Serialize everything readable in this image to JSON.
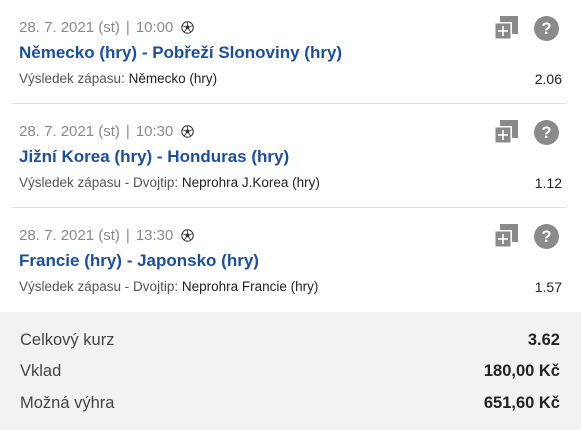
{
  "bets": [
    {
      "date": "28. 7. 2021 (st)",
      "time": "10:00",
      "match": "Německo (hry) - Pobřeží Slonoviny (hry)",
      "market": "Výsledek zápasu:",
      "pick": "Německo (hry)",
      "odd": "2.06"
    },
    {
      "date": "28. 7. 2021 (st)",
      "time": "10:30",
      "match": "Jižní Korea (hry) - Honduras (hry)",
      "market": "Výsledek zápasu - Dvojtip:",
      "pick": "Neprohra J.Korea (hry)",
      "odd": "1.12"
    },
    {
      "date": "28. 7. 2021 (st)",
      "time": "13:30",
      "match": "Francie (hry) - Japonsko (hry)",
      "market": "Výsledek zápasu - Dvojtip:",
      "pick": "Neprohra Francie (hry)",
      "odd": "1.57"
    }
  ],
  "summary": {
    "total_odds_label": "Celkový kurz",
    "total_odds_value": "3.62",
    "stake_label": "Vklad",
    "stake_value": "180,00 Kč",
    "win_label": "Možná výhra",
    "win_value": "651,60 Kč"
  },
  "icons": {
    "add": "add-to-betslip-icon",
    "help": "help-icon",
    "sport": "soccer-ball-icon"
  },
  "colors": {
    "match_title": "#1b4fa0",
    "icon": "#8a8a8a",
    "summary_bg": "#f2f2f2"
  }
}
